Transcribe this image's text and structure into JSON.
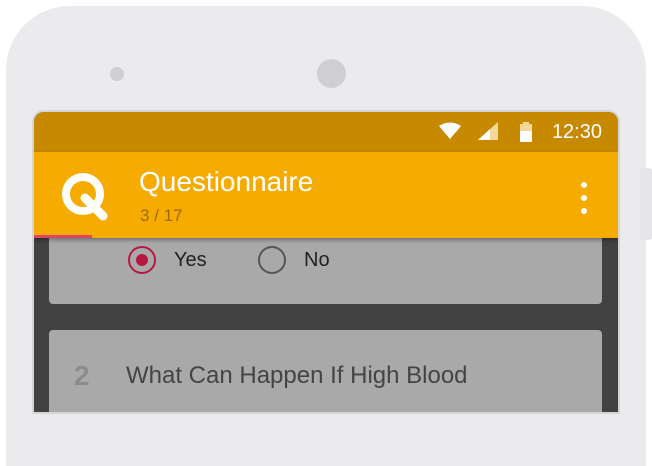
{
  "status_bar": {
    "time": "12:30",
    "icons": [
      "wifi-icon",
      "signal-icon",
      "battery-icon"
    ]
  },
  "app_bar": {
    "title": "Questionnaire",
    "progress_text": "3 / 17",
    "progress_fraction": 0.1,
    "logo": "questionnaire-logo-icon",
    "menu_icon": "more-vert-icon"
  },
  "answer_options": [
    {
      "label": "Yes",
      "selected": true
    },
    {
      "label": "No",
      "selected": false
    }
  ],
  "question": {
    "number": "2",
    "text": "What Can Happen If High Blood"
  },
  "colors": {
    "status_bar": "#c68900",
    "app_bar": "#f5ab00",
    "accent": "#b7183f",
    "progress": "#e04463",
    "card": "#a9a9a9",
    "background": "#424242"
  }
}
